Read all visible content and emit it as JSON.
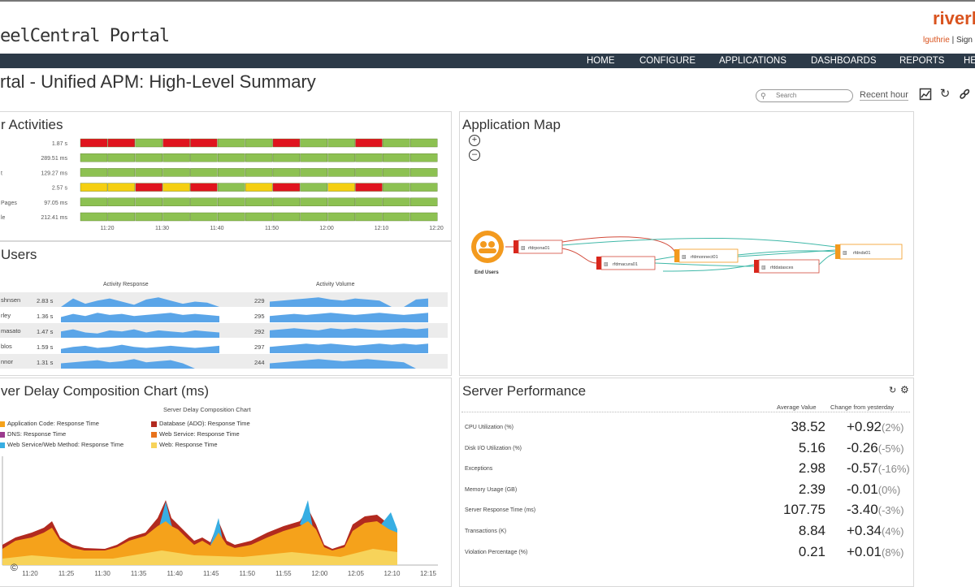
{
  "header": {
    "app_title": "eelCentral Portal",
    "brand": "riverb",
    "user": "lguthrie",
    "user_action": "Sign"
  },
  "nav": [
    "HOME",
    "CONFIGURE",
    "APPLICATIONS",
    "DASHBOARDS",
    "REPORTS",
    "HE"
  ],
  "page": {
    "title": "rtal - Unified APM: High-Level Summary",
    "search_placeholder": "Search",
    "time_range": "Recent hour"
  },
  "icons": {
    "search": "search-icon",
    "chart": "chart-icon",
    "refresh": "refresh-icon",
    "link": "link-icon",
    "zoom_in": "zoom-in-icon",
    "zoom_out": "zoom-out-icon",
    "gear": "gear-icon"
  },
  "colors": {
    "nav_bg": "#2c3a48",
    "brand": "#d9531e",
    "status_green": "#8dc152",
    "status_red": "#e0141e",
    "status_yellow": "#f5cf11",
    "sparkline": "#5aa5e8",
    "series_app_code": "#f5a21b",
    "series_db": "#b22a1f",
    "series_web_service": "#37aee3",
    "series_web_response": "#f7d35a",
    "series_dns": "#9b3a8e",
    "series_svc_resp": "#e8721c"
  },
  "user_activities": {
    "title": "r Activities",
    "rows": [
      {
        "label": "",
        "value": "1.87 s",
        "statuses": [
          "R",
          "R",
          "G",
          "R",
          "R",
          "G",
          "G",
          "R",
          "G",
          "G",
          "R",
          "G",
          "G"
        ]
      },
      {
        "label": "",
        "value": "289.51 ms",
        "statuses": [
          "G",
          "G",
          "G",
          "G",
          "G",
          "G",
          "G",
          "G",
          "G",
          "G",
          "G",
          "G",
          "G"
        ]
      },
      {
        "label": "t",
        "value": "129.27 ms",
        "statuses": [
          "G",
          "G",
          "G",
          "G",
          "G",
          "G",
          "G",
          "G",
          "G",
          "G",
          "G",
          "G",
          "G"
        ]
      },
      {
        "label": "",
        "value": "2.57 s",
        "statuses": [
          "Y",
          "Y",
          "R",
          "Y",
          "R",
          "G",
          "Y",
          "R",
          "G",
          "Y",
          "R",
          "G",
          "G"
        ]
      },
      {
        "label": "Pages",
        "value": "97.05 ms",
        "statuses": [
          "G",
          "G",
          "G",
          "G",
          "G",
          "G",
          "G",
          "G",
          "G",
          "G",
          "G",
          "G",
          "G"
        ]
      },
      {
        "label": "le",
        "value": "212.41 ms",
        "statuses": [
          "G",
          "G",
          "G",
          "G",
          "G",
          "G",
          "G",
          "G",
          "G",
          "G",
          "G",
          "G",
          "G"
        ]
      }
    ],
    "time_ticks": [
      "11:20",
      "11:30",
      "11:40",
      "11:50",
      "12:00",
      "12:10",
      "12:20"
    ]
  },
  "users": {
    "title": " Users",
    "col_response": "Activity Response",
    "col_volume": "Activity Volume",
    "rows": [
      {
        "name": "shnsen",
        "response": "2.83 s",
        "volume": "229"
      },
      {
        "name": "rley",
        "response": "1.36 s",
        "volume": "295"
      },
      {
        "name": "masato",
        "response": "1.47 s",
        "volume": "292"
      },
      {
        "name": "blos",
        "response": "1.59 s",
        "volume": "297"
      },
      {
        "name": "nnor",
        "response": "1.31 s",
        "volume": "244"
      }
    ]
  },
  "app_map": {
    "title": "Application Map",
    "end_users_label": "End Users",
    "nodes": [
      "rfdrpona01",
      "rfdmacura01",
      "rfdmonnect01",
      "rfddatasces",
      "rfdnds01"
    ]
  },
  "delay_chart": {
    "title": "ver Delay Composition Chart (ms)",
    "chart_title": "Server Delay Composition Chart",
    "copyright_mark": "©",
    "legend": [
      {
        "name": "Application Code: Response Time",
        "color": "#f5a21b"
      },
      {
        "name": "Database (ADO): Response Time",
        "color": "#b22a1f"
      },
      {
        "name": "DNS: Response Time",
        "color": "#9b3a8e"
      },
      {
        "name": "Web Service: Response Time",
        "color": "#e8721c"
      },
      {
        "name": "Web Service/Web Method: Response Time",
        "color": "#37aee3"
      },
      {
        "name": "Web: Response Time",
        "color": "#f7d35a"
      }
    ],
    "x_ticks": [
      "11:20",
      "11:25",
      "11:30",
      "11:35",
      "11:40",
      "11:45",
      "11:50",
      "11:55",
      "12:00",
      "12:05",
      "12:10",
      "12:15"
    ]
  },
  "server_performance": {
    "title": "Server Performance",
    "col_avg": "Average Value",
    "col_change": "Change from yesterday",
    "rows": [
      {
        "name": "CPU Utilization (%)",
        "value": "38.52",
        "change": "+0.92",
        "pct": "(2%)"
      },
      {
        "name": "Disk I/O Utilization (%)",
        "value": "5.16",
        "change": "-0.26",
        "pct": "(-5%)"
      },
      {
        "name": "Exceptions",
        "value": "2.98",
        "change": "-0.57",
        "pct": "(-16%)"
      },
      {
        "name": "Memory Usage (GB)",
        "value": "2.39",
        "change": "-0.01",
        "pct": "(0%)"
      },
      {
        "name": "Server Response Time (ms)",
        "value": "107.75",
        "change": "-3.40",
        "pct": "(-3%)"
      },
      {
        "name": "Transactions (K)",
        "value": "8.84",
        "change": "+0.34",
        "pct": "(4%)"
      },
      {
        "name": "Violation Percentage (%)",
        "value": "0.21",
        "change": "+0.01",
        "pct": "(8%)"
      }
    ]
  }
}
